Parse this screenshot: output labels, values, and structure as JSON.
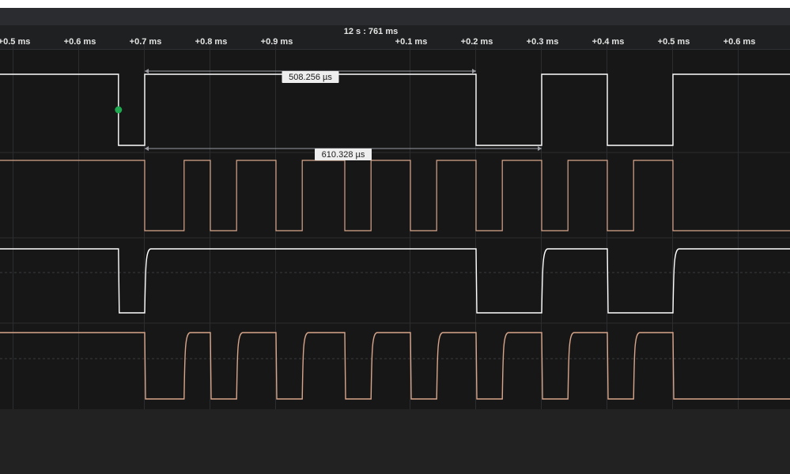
{
  "timeline": {
    "reference_label": "12 s : 761 ms",
    "tick_labels": [
      "+0.5 ms",
      "+0.6 ms",
      "+0.7 ms",
      "+0.8 ms",
      "+0.9 ms",
      "+0.1 ms",
      "+0.2 ms",
      "+0.3 ms",
      "+0.4 ms",
      "+0.5 ms",
      "+0.6 ms"
    ],
    "tick_times_ms": [
      -0.5,
      -0.4,
      -0.3,
      -0.2,
      -0.1,
      0.1,
      0.2,
      0.3,
      0.4,
      0.5,
      0.6
    ]
  },
  "measurements": [
    {
      "label": "508.256 µs",
      "start_ms": -0.3,
      "end_ms": 0.2,
      "channel": 0
    },
    {
      "label": "610.328 µs",
      "start_ms": -0.3,
      "end_ms": 0.3,
      "channel": 1
    }
  ],
  "channels": [
    {
      "name": "digital-channel-0",
      "kind": "digital",
      "color": "#ffffff",
      "edges_ms": [
        -0.34,
        -0.3,
        0.2,
        0.3,
        0.4,
        0.5
      ],
      "initial": 1
    },
    {
      "name": "digital-channel-1",
      "kind": "digital",
      "color": "#d8a58a",
      "edges_ms": [
        -0.3,
        -0.24,
        -0.2,
        -0.16,
        -0.1,
        -0.06,
        0,
        0.04,
        0.1,
        0.14,
        0.2,
        0.24,
        0.3,
        0.34,
        0.4,
        0.44,
        0.5
      ],
      "initial": 1
    },
    {
      "name": "analog-channel-2",
      "kind": "analog",
      "color": "#ffffff",
      "edges_ms": [
        -0.34,
        -0.3,
        0.2,
        0.3,
        0.4,
        0.5
      ],
      "initial": 1
    },
    {
      "name": "analog-channel-3",
      "kind": "analog",
      "color": "#d8a58a",
      "edges_ms": [
        -0.3,
        -0.24,
        -0.2,
        -0.16,
        -0.1,
        -0.06,
        0,
        0.04,
        0.1,
        0.14,
        0.2,
        0.24,
        0.3,
        0.34,
        0.4,
        0.44,
        0.5
      ],
      "initial": 1
    }
  ],
  "marker": {
    "time_ms": -0.34,
    "color": "#1fa84f"
  },
  "colors": {
    "background": "#222223",
    "track": "#171717",
    "grid": "#2c2d30",
    "measure_line": "#9a9ba0",
    "label_bg": "#eeeeee"
  }
}
